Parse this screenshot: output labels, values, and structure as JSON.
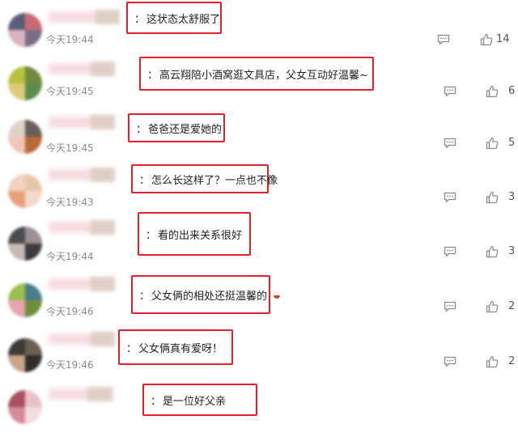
{
  "comments": [
    {
      "text": "这状态太舒服了",
      "time_label": "今天19:44",
      "likes": "14",
      "avatar_colors": [
        "#5b5d7a",
        "#c96a70",
        "#d8b4bd",
        "#7a6e85"
      ]
    },
    {
      "text": "高云翔陪小酒窝逛文具店，父女互动好温馨~",
      "time_label": "今天19:45",
      "likes": "6",
      "avatar_colors": [
        "#b7c23c",
        "#6f8a3e",
        "#e0c97a",
        "#5a8d4a"
      ]
    },
    {
      "text": "爸爸还是爱她的",
      "time_label": "今天19:45",
      "likes": "5",
      "avatar_colors": [
        "#e1d2c9",
        "#6a5e59",
        "#f2c6b8",
        "#b86a3a"
      ]
    },
    {
      "text": "怎么长这样了？一点也不像",
      "time_label": "今天19:43",
      "likes": "3",
      "avatar_colors": [
        "#f0d3c0",
        "#e7c6a8",
        "#e8a07c",
        "#f2d9c8"
      ]
    },
    {
      "text": "看的出来关系很好",
      "time_label": "今天19:44",
      "likes": "3",
      "avatar_colors": [
        "#4c4b52",
        "#9d8f92",
        "#c6b8b4",
        "#3e3a40"
      ]
    },
    {
      "text": "父女俩的相处还挺温馨的",
      "time_label": "今天19:46",
      "likes": "2",
      "avatar_colors": [
        "#9bbf4a",
        "#4a7d8c",
        "#e9a3b0",
        "#6b8f3a"
      ]
    },
    {
      "text": "父女俩真有爱呀！",
      "time_label": "今天19:46",
      "likes": "2",
      "avatar_colors": [
        "#3d3a38",
        "#6a5e52",
        "#c8a58a",
        "#2e2c2a"
      ]
    },
    {
      "text": "是一位好父亲",
      "time_label": "",
      "likes": "",
      "avatar_colors": [
        "#a8505f",
        "#e8c2c9",
        "#d68a96",
        "#f2dde0"
      ]
    }
  ],
  "colors": {
    "highlight_border": "#e0202b",
    "icon_gray": "#8c8c8c",
    "time_gray": "#8a8a8a"
  },
  "icons": {
    "reply": "comment-bubble-icon",
    "like": "thumbs-up-icon"
  }
}
